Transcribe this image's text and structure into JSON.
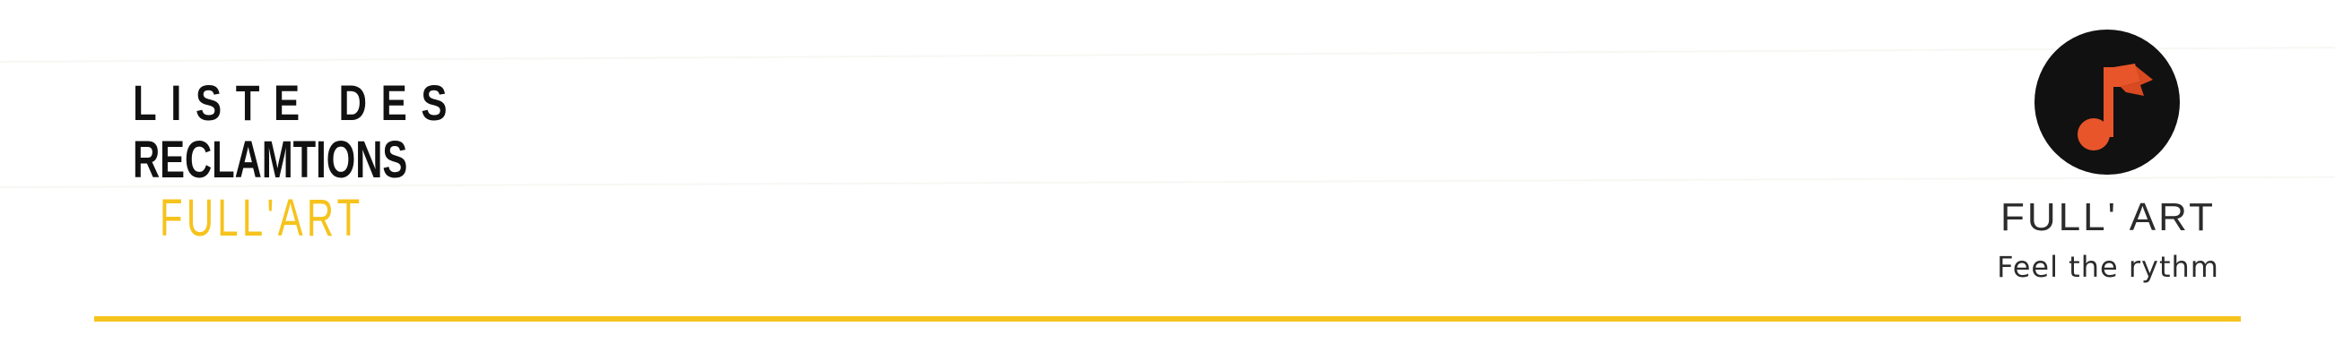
{
  "header": {
    "title_line1": "LISTE DES",
    "title_line2": "RECLAMTIONS",
    "title_line3": "FULL'ART"
  },
  "brand": {
    "logo_icon": "music-note-flag-icon",
    "name": "FULL' ART",
    "tagline": "Feel the rythm"
  },
  "colors": {
    "accent": "#f6c31c",
    "text": "#111111",
    "logo_background": "#111111",
    "logo_mark": "#e8552a"
  }
}
